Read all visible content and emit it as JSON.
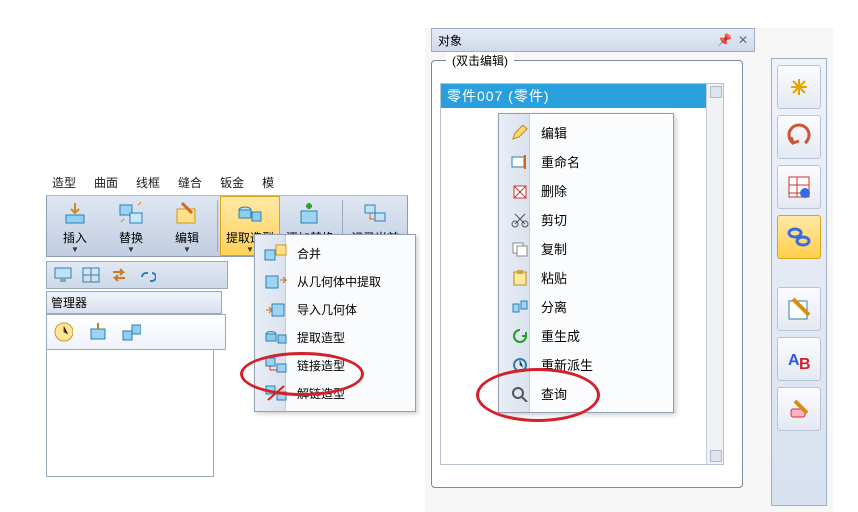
{
  "ribbon": {
    "tabs": [
      "造型",
      "曲面",
      "线框",
      "缝合",
      "钣金",
      "模"
    ],
    "items": [
      {
        "label": "插入",
        "drop": true
      },
      {
        "label": "替换",
        "drop": true
      },
      {
        "label": "编辑",
        "drop": true
      },
      {
        "label": "提取造型",
        "drop": true,
        "selected": true
      },
      {
        "label": "添加替换",
        "drop": true
      },
      {
        "label": "记录当前",
        "drop": false
      }
    ]
  },
  "manager": {
    "title": "管理器"
  },
  "dropdown": {
    "items": [
      "合并",
      "从几何体中提取",
      "导入几何体",
      "提取造型",
      "链接造型",
      "解链造型"
    ]
  },
  "objects": {
    "title": "对象",
    "legend": "(双击编辑)",
    "selected": "零件007  (零件)"
  },
  "context": {
    "items": [
      "编辑",
      "重命名",
      "删除",
      "剪切",
      "复制",
      "粘贴",
      "分离",
      "重生成",
      "重新派生",
      "查询"
    ]
  },
  "side_tools": [
    {
      "name": "highlight-icon"
    },
    {
      "name": "rotate-icon"
    },
    {
      "name": "table-link-icon"
    },
    {
      "name": "link-icon",
      "selected": true
    },
    {
      "gap": true
    },
    {
      "name": "edit-note-icon"
    },
    {
      "name": "ab-icon"
    },
    {
      "name": "eraser-icon"
    }
  ]
}
